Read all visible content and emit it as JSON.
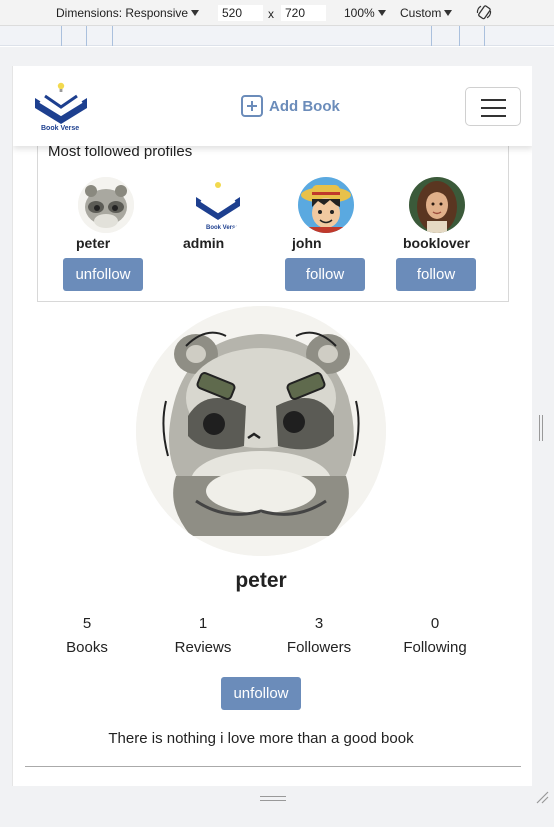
{
  "devtools": {
    "dimensions_label": "Dimensions: Responsive",
    "width": "520",
    "times": "x",
    "height": "720",
    "zoom": "100%",
    "throttle": "Custom"
  },
  "navbar": {
    "logo_text": "Book Verse",
    "add_book_label": "Add Book"
  },
  "followed": {
    "title": "Most followed profiles",
    "profiles": [
      {
        "name": "peter",
        "button": "unfollow"
      },
      {
        "name": "admin",
        "button": ""
      },
      {
        "name": "john",
        "button": "follow"
      },
      {
        "name": "booklover",
        "button": "follow"
      }
    ]
  },
  "profile": {
    "username": "peter",
    "stats": [
      {
        "value": "5",
        "label": "Books"
      },
      {
        "value": "1",
        "label": "Reviews"
      },
      {
        "value": "3",
        "label": "Followers"
      },
      {
        "value": "0",
        "label": "Following"
      }
    ],
    "action_button": "unfollow",
    "bio": "There is nothing i love more than a good book"
  },
  "colors": {
    "accent": "#6b8cba",
    "logo_blue": "#1d3f8f"
  }
}
